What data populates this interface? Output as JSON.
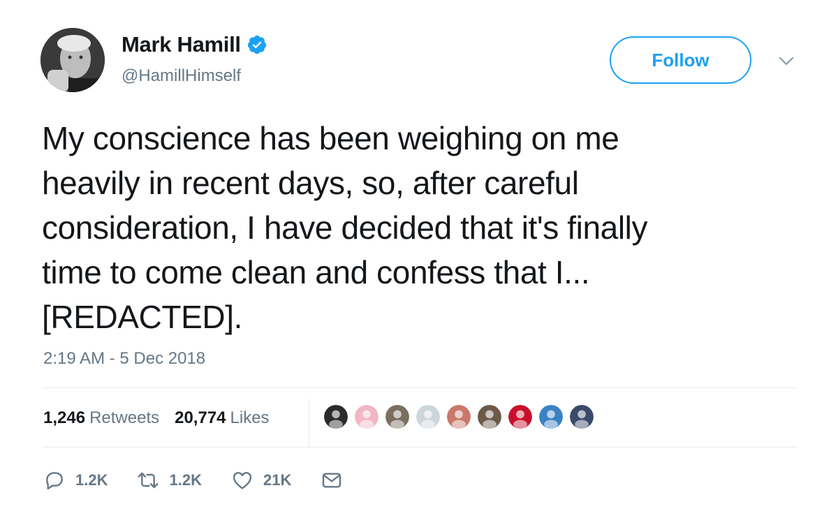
{
  "tweet": {
    "author": {
      "display_name": "Mark Hamill",
      "handle": "@HamillHimself",
      "verified": true,
      "avatar_icon": "user-avatar"
    },
    "follow_label": "Follow",
    "text_lines": [
      "My conscience has been weighing on me",
      "heavily in recent days, so, after careful",
      "consideration, I have decided that it's finally",
      "time to come clean and confess that I...",
      "[REDACTED]."
    ],
    "timestamp": "2:19 AM - 5 Dec 2018",
    "stats": {
      "retweets_count": "1,246",
      "retweets_label": "Retweets",
      "likes_count": "20,774",
      "likes_label": "Likes"
    },
    "likers": [
      {
        "icon": "skull-face-avatar",
        "color": "#2b2b2b"
      },
      {
        "icon": "cartoon-girl-avatar",
        "color": "#f2b6c6"
      },
      {
        "icon": "character-avatar",
        "color": "#7a6e5f"
      },
      {
        "icon": "default-user-avatar",
        "color": "#ccd6dd"
      },
      {
        "icon": "photo-avatar",
        "color": "#c9786a"
      },
      {
        "icon": "photo-avatar",
        "color": "#6b5a4a"
      },
      {
        "icon": "lego-avatar",
        "color": "#c8102e"
      },
      {
        "icon": "shark-avatar",
        "color": "#3b82c4"
      },
      {
        "icon": "cartoon-avatar",
        "color": "#3a4a6b"
      }
    ],
    "actions": {
      "reply_count": "1.2K",
      "retweet_count": "1.2K",
      "like_count": "21K"
    },
    "colors": {
      "accent": "#1da1f2",
      "text_primary": "#14171a",
      "text_secondary": "#657786",
      "divider": "#e6ecf0"
    }
  }
}
